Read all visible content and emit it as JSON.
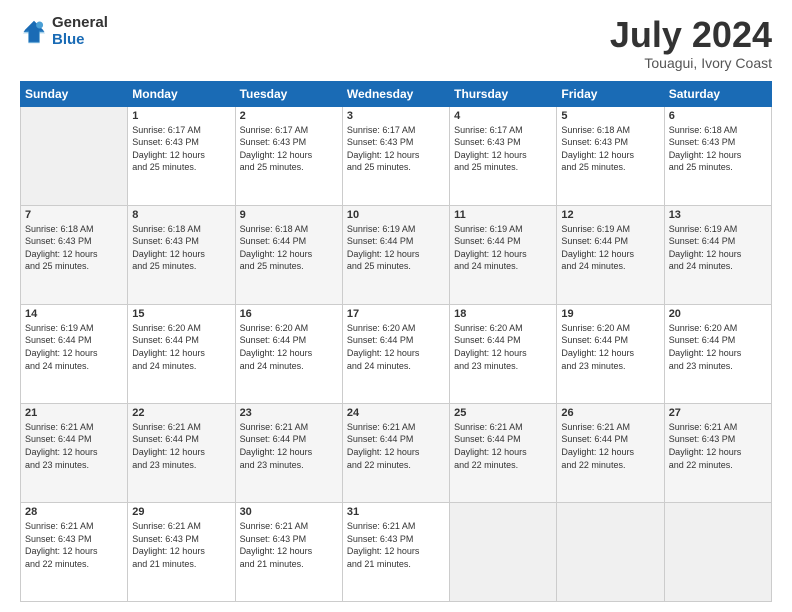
{
  "logo": {
    "general": "General",
    "blue": "Blue"
  },
  "header": {
    "title": "July 2024",
    "subtitle": "Touagui, Ivory Coast"
  },
  "columns": [
    "Sunday",
    "Monday",
    "Tuesday",
    "Wednesday",
    "Thursday",
    "Friday",
    "Saturday"
  ],
  "weeks": [
    [
      {
        "day": "",
        "sunrise": "",
        "sunset": "",
        "daylight1": "",
        "daylight2": ""
      },
      {
        "day": "1",
        "sunrise": "Sunrise: 6:17 AM",
        "sunset": "Sunset: 6:43 PM",
        "daylight1": "Daylight: 12 hours",
        "daylight2": "and 25 minutes."
      },
      {
        "day": "2",
        "sunrise": "Sunrise: 6:17 AM",
        "sunset": "Sunset: 6:43 PM",
        "daylight1": "Daylight: 12 hours",
        "daylight2": "and 25 minutes."
      },
      {
        "day": "3",
        "sunrise": "Sunrise: 6:17 AM",
        "sunset": "Sunset: 6:43 PM",
        "daylight1": "Daylight: 12 hours",
        "daylight2": "and 25 minutes."
      },
      {
        "day": "4",
        "sunrise": "Sunrise: 6:17 AM",
        "sunset": "Sunset: 6:43 PM",
        "daylight1": "Daylight: 12 hours",
        "daylight2": "and 25 minutes."
      },
      {
        "day": "5",
        "sunrise": "Sunrise: 6:18 AM",
        "sunset": "Sunset: 6:43 PM",
        "daylight1": "Daylight: 12 hours",
        "daylight2": "and 25 minutes."
      },
      {
        "day": "6",
        "sunrise": "Sunrise: 6:18 AM",
        "sunset": "Sunset: 6:43 PM",
        "daylight1": "Daylight: 12 hours",
        "daylight2": "and 25 minutes."
      }
    ],
    [
      {
        "day": "7",
        "sunrise": "Sunrise: 6:18 AM",
        "sunset": "Sunset: 6:43 PM",
        "daylight1": "Daylight: 12 hours",
        "daylight2": "and 25 minutes."
      },
      {
        "day": "8",
        "sunrise": "Sunrise: 6:18 AM",
        "sunset": "Sunset: 6:43 PM",
        "daylight1": "Daylight: 12 hours",
        "daylight2": "and 25 minutes."
      },
      {
        "day": "9",
        "sunrise": "Sunrise: 6:18 AM",
        "sunset": "Sunset: 6:44 PM",
        "daylight1": "Daylight: 12 hours",
        "daylight2": "and 25 minutes."
      },
      {
        "day": "10",
        "sunrise": "Sunrise: 6:19 AM",
        "sunset": "Sunset: 6:44 PM",
        "daylight1": "Daylight: 12 hours",
        "daylight2": "and 25 minutes."
      },
      {
        "day": "11",
        "sunrise": "Sunrise: 6:19 AM",
        "sunset": "Sunset: 6:44 PM",
        "daylight1": "Daylight: 12 hours",
        "daylight2": "and 24 minutes."
      },
      {
        "day": "12",
        "sunrise": "Sunrise: 6:19 AM",
        "sunset": "Sunset: 6:44 PM",
        "daylight1": "Daylight: 12 hours",
        "daylight2": "and 24 minutes."
      },
      {
        "day": "13",
        "sunrise": "Sunrise: 6:19 AM",
        "sunset": "Sunset: 6:44 PM",
        "daylight1": "Daylight: 12 hours",
        "daylight2": "and 24 minutes."
      }
    ],
    [
      {
        "day": "14",
        "sunrise": "Sunrise: 6:19 AM",
        "sunset": "Sunset: 6:44 PM",
        "daylight1": "Daylight: 12 hours",
        "daylight2": "and 24 minutes."
      },
      {
        "day": "15",
        "sunrise": "Sunrise: 6:20 AM",
        "sunset": "Sunset: 6:44 PM",
        "daylight1": "Daylight: 12 hours",
        "daylight2": "and 24 minutes."
      },
      {
        "day": "16",
        "sunrise": "Sunrise: 6:20 AM",
        "sunset": "Sunset: 6:44 PM",
        "daylight1": "Daylight: 12 hours",
        "daylight2": "and 24 minutes."
      },
      {
        "day": "17",
        "sunrise": "Sunrise: 6:20 AM",
        "sunset": "Sunset: 6:44 PM",
        "daylight1": "Daylight: 12 hours",
        "daylight2": "and 24 minutes."
      },
      {
        "day": "18",
        "sunrise": "Sunrise: 6:20 AM",
        "sunset": "Sunset: 6:44 PM",
        "daylight1": "Daylight: 12 hours",
        "daylight2": "and 23 minutes."
      },
      {
        "day": "19",
        "sunrise": "Sunrise: 6:20 AM",
        "sunset": "Sunset: 6:44 PM",
        "daylight1": "Daylight: 12 hours",
        "daylight2": "and 23 minutes."
      },
      {
        "day": "20",
        "sunrise": "Sunrise: 6:20 AM",
        "sunset": "Sunset: 6:44 PM",
        "daylight1": "Daylight: 12 hours",
        "daylight2": "and 23 minutes."
      }
    ],
    [
      {
        "day": "21",
        "sunrise": "Sunrise: 6:21 AM",
        "sunset": "Sunset: 6:44 PM",
        "daylight1": "Daylight: 12 hours",
        "daylight2": "and 23 minutes."
      },
      {
        "day": "22",
        "sunrise": "Sunrise: 6:21 AM",
        "sunset": "Sunset: 6:44 PM",
        "daylight1": "Daylight: 12 hours",
        "daylight2": "and 23 minutes."
      },
      {
        "day": "23",
        "sunrise": "Sunrise: 6:21 AM",
        "sunset": "Sunset: 6:44 PM",
        "daylight1": "Daylight: 12 hours",
        "daylight2": "and 23 minutes."
      },
      {
        "day": "24",
        "sunrise": "Sunrise: 6:21 AM",
        "sunset": "Sunset: 6:44 PM",
        "daylight1": "Daylight: 12 hours",
        "daylight2": "and 22 minutes."
      },
      {
        "day": "25",
        "sunrise": "Sunrise: 6:21 AM",
        "sunset": "Sunset: 6:44 PM",
        "daylight1": "Daylight: 12 hours",
        "daylight2": "and 22 minutes."
      },
      {
        "day": "26",
        "sunrise": "Sunrise: 6:21 AM",
        "sunset": "Sunset: 6:44 PM",
        "daylight1": "Daylight: 12 hours",
        "daylight2": "and 22 minutes."
      },
      {
        "day": "27",
        "sunrise": "Sunrise: 6:21 AM",
        "sunset": "Sunset: 6:43 PM",
        "daylight1": "Daylight: 12 hours",
        "daylight2": "and 22 minutes."
      }
    ],
    [
      {
        "day": "28",
        "sunrise": "Sunrise: 6:21 AM",
        "sunset": "Sunset: 6:43 PM",
        "daylight1": "Daylight: 12 hours",
        "daylight2": "and 22 minutes."
      },
      {
        "day": "29",
        "sunrise": "Sunrise: 6:21 AM",
        "sunset": "Sunset: 6:43 PM",
        "daylight1": "Daylight: 12 hours",
        "daylight2": "and 21 minutes."
      },
      {
        "day": "30",
        "sunrise": "Sunrise: 6:21 AM",
        "sunset": "Sunset: 6:43 PM",
        "daylight1": "Daylight: 12 hours",
        "daylight2": "and 21 minutes."
      },
      {
        "day": "31",
        "sunrise": "Sunrise: 6:21 AM",
        "sunset": "Sunset: 6:43 PM",
        "daylight1": "Daylight: 12 hours",
        "daylight2": "and 21 minutes."
      },
      {
        "day": "",
        "sunrise": "",
        "sunset": "",
        "daylight1": "",
        "daylight2": ""
      },
      {
        "day": "",
        "sunrise": "",
        "sunset": "",
        "daylight1": "",
        "daylight2": ""
      },
      {
        "day": "",
        "sunrise": "",
        "sunset": "",
        "daylight1": "",
        "daylight2": ""
      }
    ]
  ]
}
